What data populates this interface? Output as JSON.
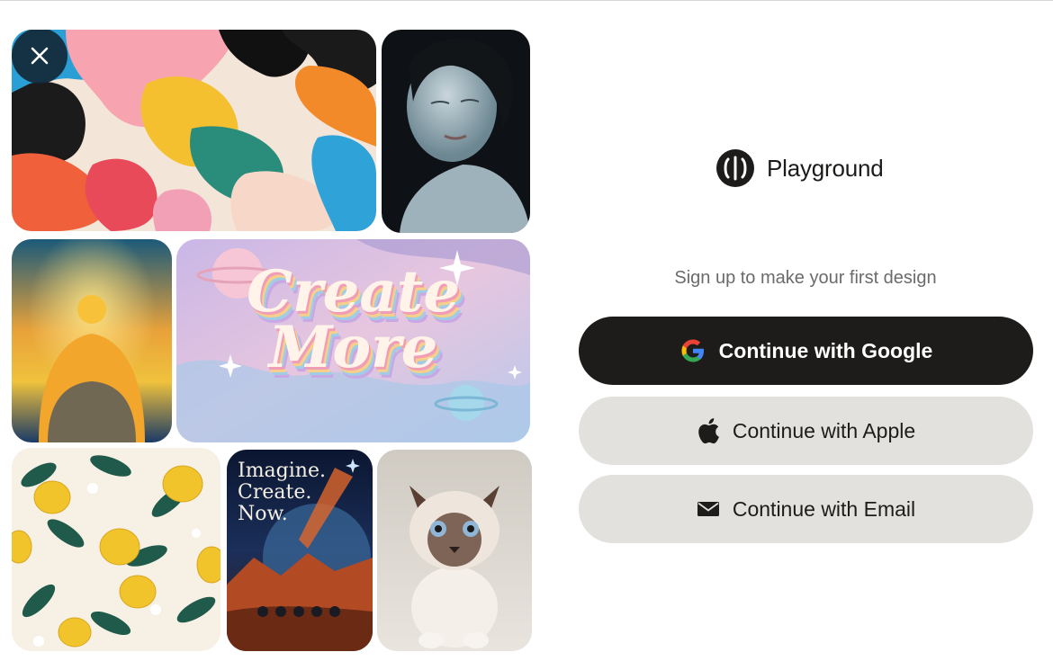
{
  "brand": {
    "name": "Playground"
  },
  "auth": {
    "subtitle": "Sign up to make your first design",
    "buttons": {
      "google": "Continue with Google",
      "apple": "Continue with Apple",
      "email": "Continue with Email"
    }
  },
  "gallery": {
    "banner_text": "Create More",
    "poster_text": [
      "Imagine.",
      "Create.",
      "Now."
    ]
  },
  "icons": {
    "close": "close-icon",
    "logo": "playground-logo-icon",
    "google": "google-icon",
    "apple": "apple-icon",
    "email": "mail-icon"
  },
  "colors": {
    "primary_button": "#1e1c1b",
    "secondary_button": "#e3e1de",
    "subtitle": "#6b6b6b"
  }
}
